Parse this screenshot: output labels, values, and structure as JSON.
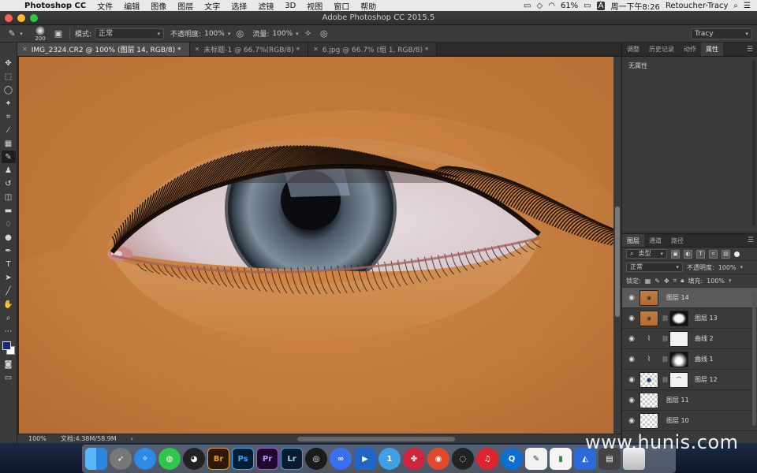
{
  "menubar": {
    "app_name": "Photoshop CC",
    "menus": [
      "文件",
      "编辑",
      "图像",
      "图层",
      "文字",
      "选择",
      "滤镜",
      "3D",
      "视图",
      "窗口",
      "帮助"
    ],
    "battery": "61%",
    "input_method": "A",
    "clock": "周一下午8:26",
    "user": "Retoucher-Tracy"
  },
  "window": {
    "title": "Adobe Photoshop CC 2015.5"
  },
  "options": {
    "brush_size": "200",
    "mode_label": "模式:",
    "mode_value": "正常",
    "opacity_label": "不透明度:",
    "opacity_value": "100%",
    "flow_label": "流量:",
    "flow_value": "100%",
    "workspace": "Tracy"
  },
  "tabs": [
    {
      "label": "IMG_2324.CR2 @ 100% (图层 14, RGB/8) *"
    },
    {
      "label": "未标题-1 @ 66.7%(RGB/8) *"
    },
    {
      "label": "6.jpg @ 66.7% (组 1, RGB/8) *"
    }
  ],
  "status": {
    "zoom": "100%",
    "doc": "文档:4.38M/58.9M"
  },
  "props_panel": {
    "tabs": [
      "调整",
      "历史记录",
      "动作",
      "属性"
    ],
    "active_tab": "属性",
    "content": "无属性"
  },
  "layers_panel": {
    "tabs": [
      "图层",
      "通道",
      "路径"
    ],
    "filter_label": "类型",
    "blend_mode": "正常",
    "opacity_label": "不透明度:",
    "opacity_value": "100%",
    "lock_label": "锁定:",
    "fill_label": "填充:",
    "fill_value": "100%",
    "layers": [
      {
        "name": "图层 14",
        "selected": true
      },
      {
        "name": "图层 13",
        "selected": false
      },
      {
        "name": "曲线 2",
        "selected": false
      },
      {
        "name": "曲线 1",
        "selected": false
      },
      {
        "name": "图层 12",
        "selected": false
      },
      {
        "name": "图层 11",
        "selected": false
      },
      {
        "name": "图层 10",
        "selected": false
      }
    ]
  },
  "dock": {
    "labels": {
      "br": "Br",
      "ps": "Ps",
      "pr": "Pr",
      "lr": "Lr",
      "one": "1"
    }
  },
  "watermark": "www.hunis.com",
  "colors": {
    "foreground_swatch": "#1d2a70",
    "background_swatch": "#ffffff",
    "skin": "#c8803f"
  }
}
